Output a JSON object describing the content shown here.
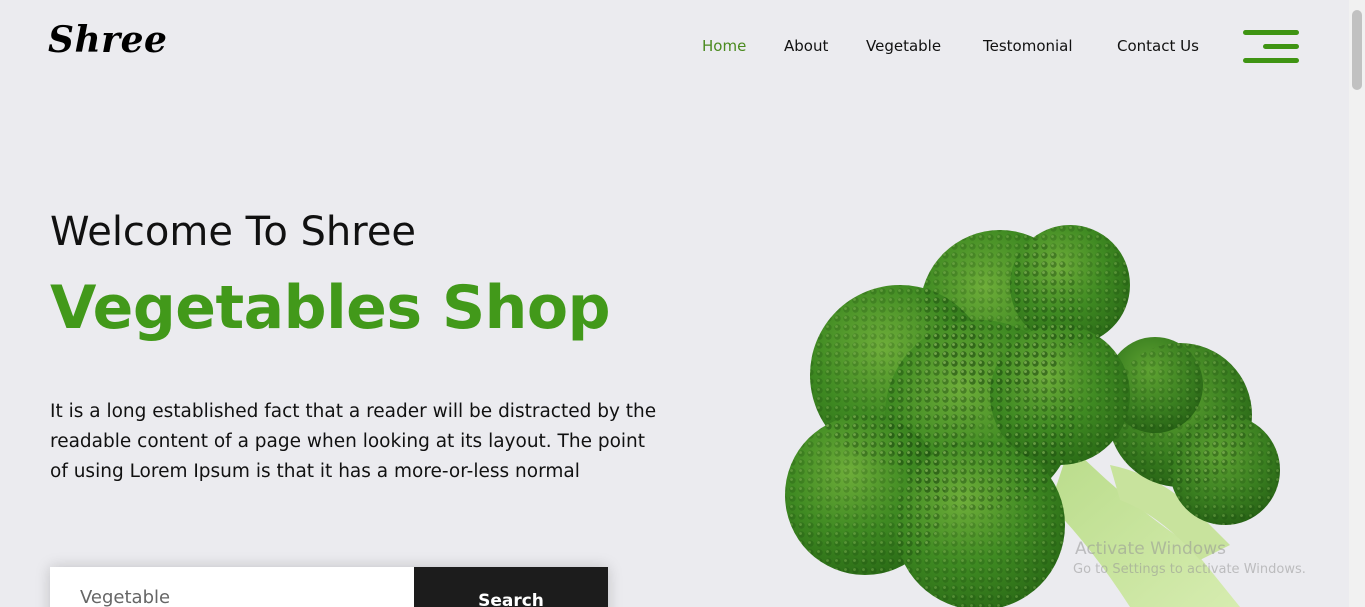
{
  "brand": {
    "logo_text": "Shree"
  },
  "nav": {
    "items": [
      {
        "label": "Home",
        "active": true
      },
      {
        "label": "About",
        "active": false
      },
      {
        "label": "Vegetable",
        "active": false
      },
      {
        "label": "Testomonial",
        "active": false
      },
      {
        "label": "Contact Us",
        "active": false
      }
    ],
    "menu_icon": "hamburger-menu-icon"
  },
  "hero": {
    "welcome": "Welcome To Shree",
    "headline": "Vegetables Shop",
    "description": "It is a long established fact that a reader will be distracted by the readable content of a page when looking at its layout. The point of using Lorem Ipsum is that it has a more-or-less normal",
    "search": {
      "placeholder": "Vegetable",
      "button_label": "Search"
    },
    "image": "broccoli-image"
  },
  "watermark": {
    "line1": "Activate Windows",
    "line2": "Go to Settings to activate Windows."
  },
  "colors": {
    "accent": "#42991a",
    "nav_active": "#4a8a1e",
    "background": "#ebebef",
    "button_dark": "#1c1c1c"
  }
}
